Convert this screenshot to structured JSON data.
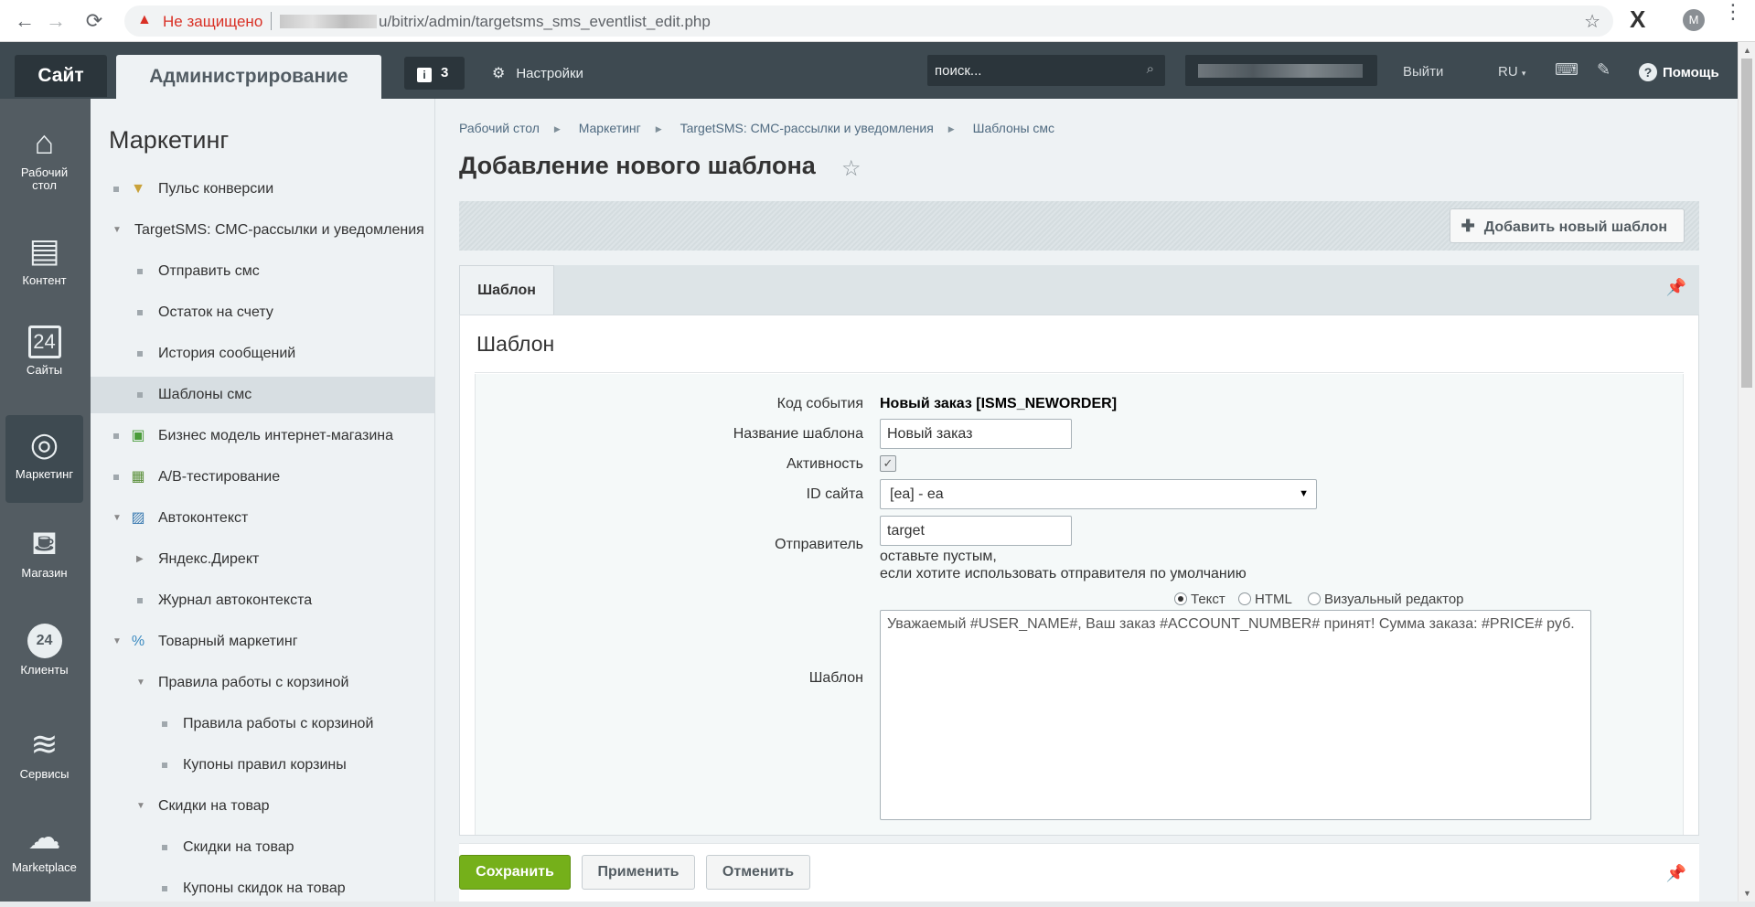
{
  "browser": {
    "back": "←",
    "forward": "→",
    "reload": "⟳",
    "insecure_label": "Не защищено",
    "url_path": "u/bitrix/admin/targetsms_sms_eventlist_edit.php",
    "profile_initial": "M"
  },
  "topbar": {
    "site_tab": "Сайт",
    "admin_tab": "Администрирование",
    "notifications_count": "3",
    "settings": "Настройки",
    "search_placeholder": "поиск...",
    "logout": "Выйти",
    "lang": "RU",
    "help": "Помощь"
  },
  "rail": [
    {
      "label": "Рабочий стол",
      "icon": "home-icon"
    },
    {
      "label": "Контент",
      "icon": "document-icon"
    },
    {
      "label": "Сайты",
      "icon": "calendar-24-icon"
    },
    {
      "label": "Маркетинг",
      "icon": "target-icon"
    },
    {
      "label": "Магазин",
      "icon": "basket-icon"
    },
    {
      "label": "Клиенты",
      "icon": "clients-24-icon"
    },
    {
      "label": "Сервисы",
      "icon": "layers-icon"
    },
    {
      "label": "Marketplace",
      "icon": "cloud-download-icon"
    }
  ],
  "menu": {
    "title": "Маркетинг",
    "items": [
      {
        "label": "Пульс конверсии"
      },
      {
        "label": "TargetSMS: СМС-рассылки и уведомления"
      },
      {
        "label": "Отправить смс"
      },
      {
        "label": "Остаток на счету"
      },
      {
        "label": "История сообщений"
      },
      {
        "label": "Шаблоны смс"
      },
      {
        "label": "Бизнес модель интернет-магазина"
      },
      {
        "label": "A/B-тестирование"
      },
      {
        "label": "Автоконтекст"
      },
      {
        "label": "Яндекс.Директ"
      },
      {
        "label": "Журнал автоконтекста"
      },
      {
        "label": "Товарный маркетинг"
      },
      {
        "label": "Правила работы с корзиной"
      },
      {
        "label": "Правила работы с корзиной"
      },
      {
        "label": "Купоны правил корзины"
      },
      {
        "label": "Скидки на товар"
      },
      {
        "label": "Скидки на товар"
      },
      {
        "label": "Купоны скидок на товар"
      }
    ]
  },
  "breadcrumbs": [
    "Рабочий стол",
    "Маркетинг",
    "TargetSMS: СМС-рассылки и уведомления",
    "Шаблоны смс"
  ],
  "page_title": "Добавление нового шаблона",
  "toolbar": {
    "add_button": "Добавить новый шаблон"
  },
  "tabs": [
    {
      "label": "Шаблон"
    }
  ],
  "panel_title": "Шаблон",
  "form": {
    "event_code_label": "Код события",
    "event_code_value": "Новый заказ [ISMS_NEWORDER]",
    "name_label": "Название шаблона",
    "name_value": "Новый заказ",
    "active_label": "Активность",
    "active_checked": true,
    "site_label": "ID сайта",
    "site_value": "[ea] - ea",
    "sender_label": "Отправитель",
    "sender_value": "target",
    "sender_hint_1": "оставьте пустым,",
    "sender_hint_2": "если хотите использовать отправителя по умолчанию",
    "format_options": [
      {
        "label": "Текст",
        "selected": true
      },
      {
        "label": "HTML",
        "selected": false
      },
      {
        "label": "Визуальный редактор",
        "selected": false
      }
    ],
    "template_label": "Шаблон",
    "template_value": "Уважаемый #USER_NAME#, Ваш заказ #ACCOUNT_NUMBER# принят! Сумма заказа: #PRICE# руб."
  },
  "buttons": {
    "save": "Сохранить",
    "apply": "Применить",
    "cancel": "Отменить"
  },
  "colors": {
    "topbar": "#3e4a51",
    "rail": "#535c62",
    "save_green": "#75b01a",
    "insecure_red": "#d93025"
  }
}
